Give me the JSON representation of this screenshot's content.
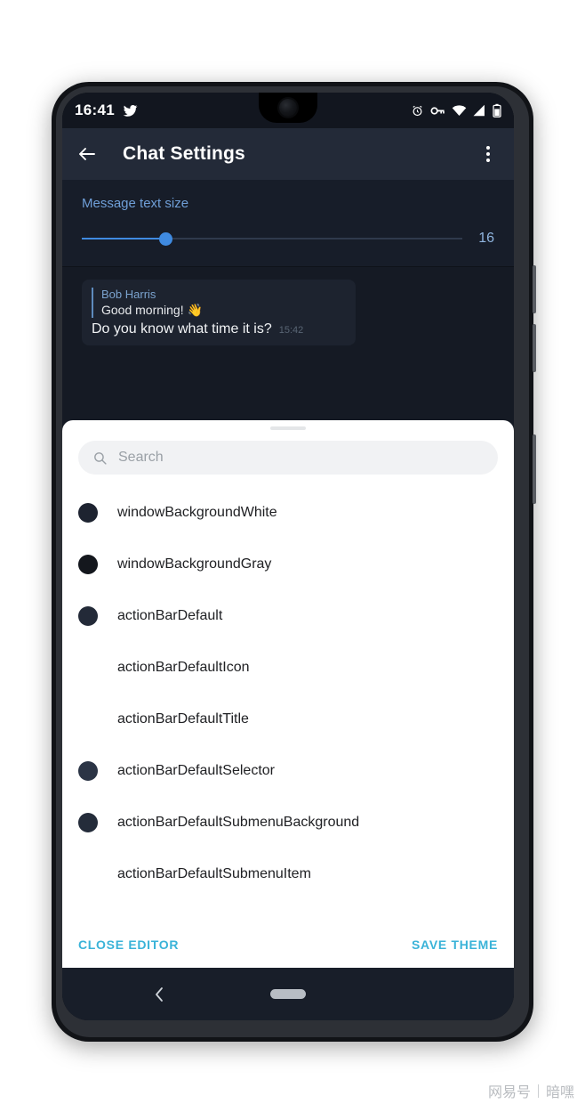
{
  "status_bar": {
    "time": "16:41",
    "left_icons": [
      "twitter-icon"
    ],
    "right_icons": [
      "alarm-icon",
      "vpn-key-icon",
      "wifi-icon",
      "signal-icon",
      "battery-icon"
    ]
  },
  "action_bar": {
    "back_icon": "back-arrow-icon",
    "title": "Chat Settings",
    "overflow_icon": "overflow-menu-icon"
  },
  "text_size": {
    "label": "Message text size",
    "value": "16",
    "percent": 22,
    "accent_color": "#3f8ae0",
    "label_color": "#6f9fd8"
  },
  "chat_preview": {
    "reply_author": "Bob Harris",
    "reply_text": "Good morning! 👋",
    "message_text": "Do you know what time it is?",
    "message_time": "15:42"
  },
  "theme_editor": {
    "search": {
      "icon": "search-icon",
      "placeholder": "Search",
      "value": ""
    },
    "color_keys": [
      {
        "label": "windowBackgroundWhite",
        "swatch": "#1d2330",
        "has_swatch": true
      },
      {
        "label": "windowBackgroundGray",
        "swatch": "#14171d",
        "has_swatch": true
      },
      {
        "label": "actionBarDefault",
        "swatch": "#232a38",
        "has_swatch": true
      },
      {
        "label": "actionBarDefaultIcon",
        "swatch": "#ffffff",
        "has_swatch": false
      },
      {
        "label": "actionBarDefaultTitle",
        "swatch": "#ffffff",
        "has_swatch": false
      },
      {
        "label": "actionBarDefaultSelector",
        "swatch": "#2b3445",
        "has_swatch": true
      },
      {
        "label": "actionBarDefaultSubmenuBackground",
        "swatch": "#242c3a",
        "has_swatch": true
      },
      {
        "label": "actionBarDefaultSubmenuItem",
        "swatch": "#ffffff",
        "has_swatch": false
      }
    ],
    "close_button": "CLOSE EDITOR",
    "save_button": "SAVE THEME",
    "action_color": "#3ab3d8"
  },
  "nav_bar": {
    "back_icon": "nav-back-icon",
    "home_indicator": "nav-home-pill"
  },
  "watermark": {
    "brand": "网易号",
    "account": "暗嘿"
  }
}
